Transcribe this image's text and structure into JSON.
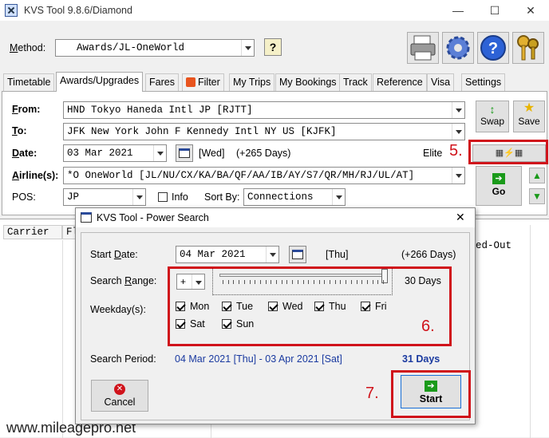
{
  "window": {
    "title": "KVS Tool 9.8.6/Diamond",
    "minimize": "—",
    "maximize": "☐",
    "close": "✕"
  },
  "toolbar": {
    "method_label": "Method:",
    "method_value": "Awards/JL-OneWorld"
  },
  "tabs": [
    "Timetable",
    "Awards/Upgrades",
    "Fares",
    "Filter",
    "My Trips",
    "My Bookings",
    "Track",
    "Reference",
    "Visa",
    "Settings"
  ],
  "active_tab": "Awards/Upgrades",
  "form": {
    "from_label": "From:",
    "from_value": "HND  Tokyo Haneda Intl JP [RJTT]",
    "to_label": "To:",
    "to_value": "JFK  New York John F Kennedy Intl NY US [KJFK]",
    "date_label": "Date:",
    "date_value": "03 Mar 2021",
    "date_weekday": "[Wed]",
    "date_offset": "(+265 Days)",
    "elite_label": "Elite",
    "airline_label": "Airline(s):",
    "airline_value": "*O  OneWorld [JL/NU/CX/KA/BA/QF/AA/IB/AY/S7/QR/MH/RJ/UL/AT]",
    "pos_label": "POS:",
    "pos_value": "JP",
    "info_label": "Info",
    "sortby_label": "Sort By:",
    "sortby_value": "Connections",
    "swap_label": "Swap",
    "save_label": "Save",
    "go_label": "Go"
  },
  "grid": {
    "col_carrier": "Carrier",
    "col_fl": "Fl",
    "col_right": "ed-Out"
  },
  "dialog": {
    "title": "KVS Tool - Power Search",
    "start_date_label": "Start Date:",
    "start_date_value": "04 Mar 2021",
    "start_weekday": "[Thu]",
    "start_offset": "(+266 Days)",
    "range_label": "Search Range:",
    "range_sign": "+",
    "range_days": "30 Days",
    "weekday_label": "Weekday(s):",
    "weekdays": [
      {
        "name": "Mon",
        "checked": true
      },
      {
        "name": "Tue",
        "checked": true
      },
      {
        "name": "Wed",
        "checked": true
      },
      {
        "name": "Thu",
        "checked": true
      },
      {
        "name": "Fri",
        "checked": true
      },
      {
        "name": "Sat",
        "checked": true
      },
      {
        "name": "Sun",
        "checked": true
      }
    ],
    "period_label": "Search Period:",
    "period_value": "04 Mar 2021 [Thu] - 03 Apr 2021 [Sat]",
    "period_days": "31 Days",
    "cancel_label": "Cancel",
    "start_label": "Start"
  },
  "annotations": {
    "step5": "5.",
    "step6": "6.",
    "step7": "7.",
    "color": "#d0131b"
  },
  "watermark": "www.mileagepro.net"
}
